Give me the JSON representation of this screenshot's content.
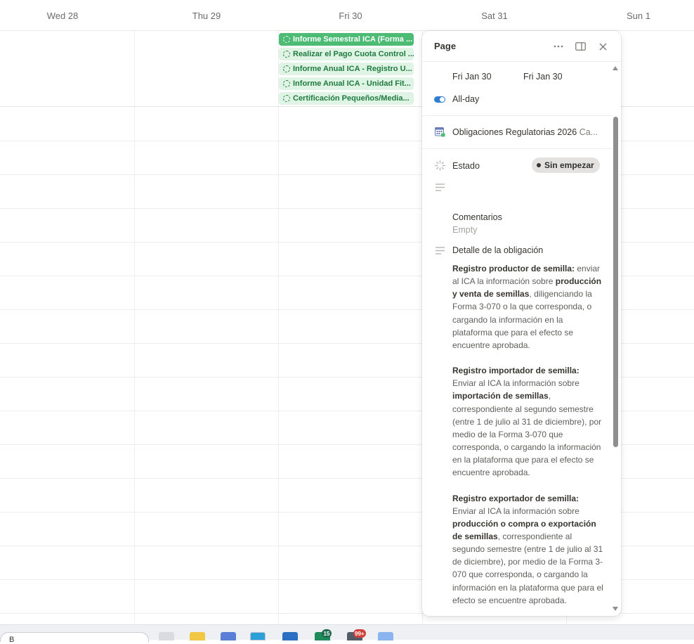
{
  "calendar": {
    "days": [
      {
        "label": "Wed 28"
      },
      {
        "label": "Thu 29"
      },
      {
        "label": "Fri 30"
      },
      {
        "label": "Sat 31"
      },
      {
        "label": "Sun 1"
      }
    ],
    "events": [
      {
        "title": "Informe Semestral ICA (Forma ...",
        "style": "solid"
      },
      {
        "title": "Realizar el Pago Cuota Control ...",
        "style": "light"
      },
      {
        "title": "Informe Anual ICA - Registro U...",
        "style": "light"
      },
      {
        "title": "Informe Anual ICA - Unidad Fit...",
        "style": "light"
      },
      {
        "title": "Certificación Pequeños/Media...",
        "style": "light"
      }
    ]
  },
  "panel": {
    "title": "Page",
    "date_start": "Fri Jan 30",
    "date_end": "Fri Jan 30",
    "allday_label": "All-day",
    "database_name": "Obligaciones Regulatorias 2026",
    "database_suffix": "Ca...",
    "status_label": "Estado",
    "status_value": "Sin empezar",
    "comments_label": "Comentarios",
    "comments_value": "Empty",
    "detail_label": "Detalle de la obligación",
    "detail": {
      "p1_head": "Registro productor de semilla:",
      "p1_a": " enviar al ICA la información sobre ",
      "p1_b": "producción y venta de semillas",
      "p1_c": ", diligenciando la Forma 3-070 o la que corresponda, o cargando la información en la plataforma que para el efecto se encuentre aprobada.",
      "p2_head": "Registro importador de semilla:",
      "p2_a": " Enviar al ICA la información sobre ",
      "p2_b": "importación de semillas",
      "p2_c": ", correspondiente al segundo semestre (entre 1 de julio al 31 de diciembre), por medio de la Forma 3-070 que corresponda, o cargando la información en la plataforma que para el efecto se encuentre aprobada.",
      "p3_head": "Registro exportador de semilla:",
      "p3_a": " Enviar al ICA la información sobre ",
      "p3_b": "producción o compra o exportación de semillas",
      "p3_c": ", correspondiente al segundo semestre (entre 1 de julio al 31 de diciembre), por medio de la Forma 3-070 que corresponda, o cargando la información en la plataforma que para el efecto se encuentre aprobada."
    },
    "icons": {
      "more": "more-icon",
      "sidepeek": "sidepeek-icon",
      "close": "close-icon"
    }
  },
  "taskbar": {
    "search_placeholder": "B",
    "badge_one": "15",
    "badge_two": "99+"
  },
  "colors": {
    "event_solid": "#4cbb73",
    "event_light": "#dff4e5",
    "toggle": "#2e7fd1",
    "status_pill": "#e3e2e0"
  }
}
